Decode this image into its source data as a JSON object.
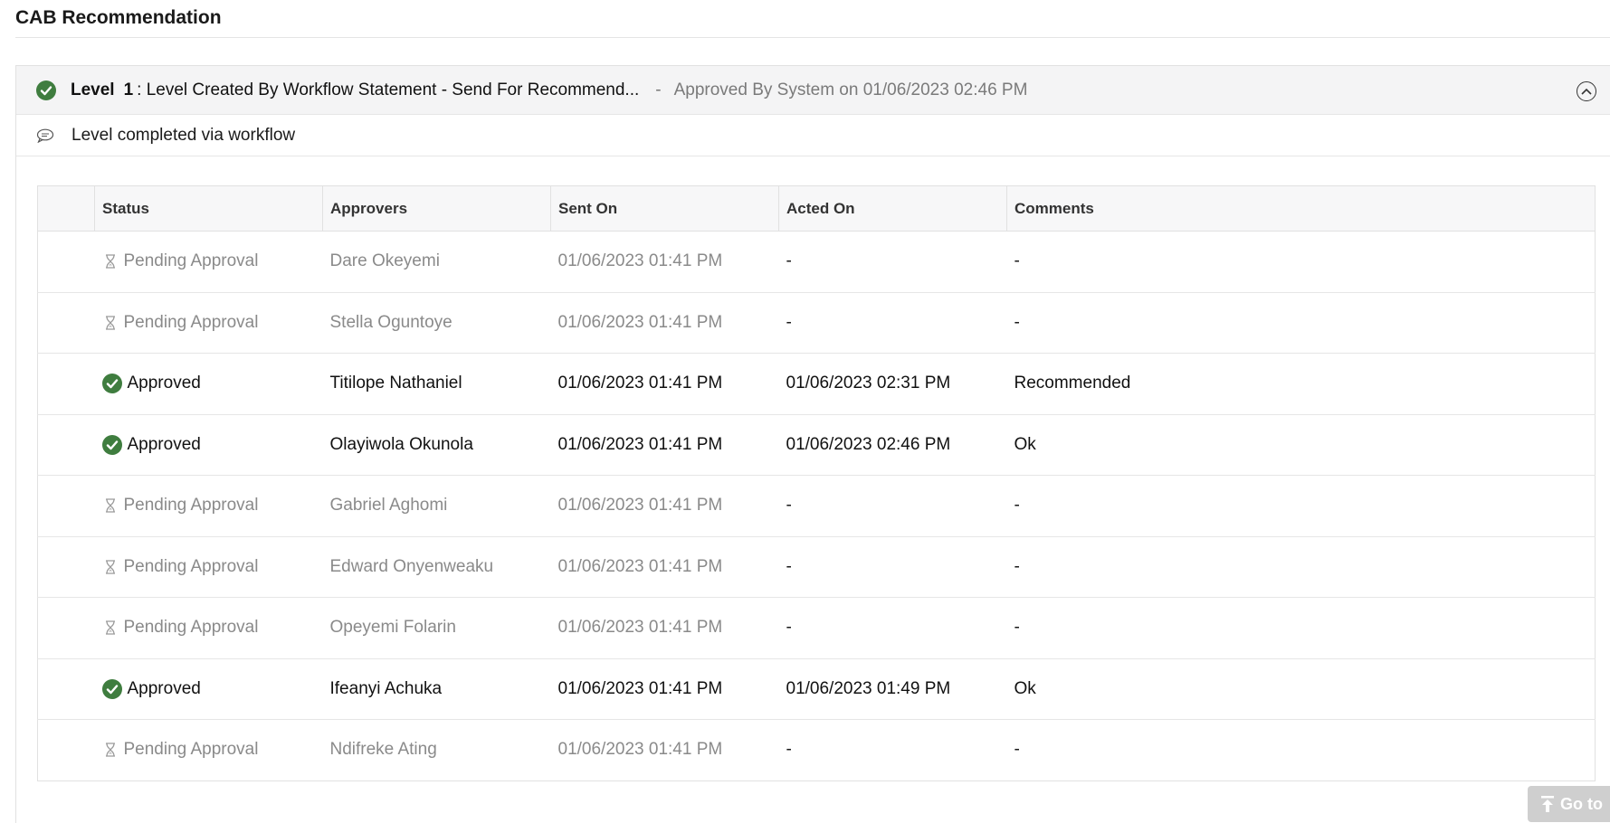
{
  "section": {
    "title": "CAB Recommendation"
  },
  "level": {
    "label": "Level",
    "number": "1",
    "name": ": Level Created By Workflow Statement - Send For Recommend...",
    "separator": "-",
    "approved_by": "Approved By System on 01/06/2023 02:46 PM",
    "note": "Level completed via workflow",
    "status_icon": "check-circle-icon",
    "collapse_icon": "chevron-up-circle-icon"
  },
  "table": {
    "headers": [
      "",
      "Status",
      "Approvers",
      "Sent On",
      "Acted On",
      "Comments"
    ],
    "rows": [
      {
        "status": "Pending Approval",
        "approver": "Dare Okeyemi",
        "sent_on": "01/06/2023 01:41 PM",
        "acted_on": "-",
        "comments": "-"
      },
      {
        "status": "Pending Approval",
        "approver": "Stella Oguntoye",
        "sent_on": "01/06/2023 01:41 PM",
        "acted_on": "-",
        "comments": "-"
      },
      {
        "status": "Approved",
        "approver": "Titilope Nathaniel",
        "sent_on": "01/06/2023 01:41 PM",
        "acted_on": "01/06/2023 02:31 PM",
        "comments": "Recommended"
      },
      {
        "status": "Approved",
        "approver": "Olayiwola Okunola",
        "sent_on": "01/06/2023 01:41 PM",
        "acted_on": "01/06/2023 02:46 PM",
        "comments": "Ok"
      },
      {
        "status": "Pending Approval",
        "approver": "Gabriel Aghomi",
        "sent_on": "01/06/2023 01:41 PM",
        "acted_on": "-",
        "comments": "-"
      },
      {
        "status": "Pending Approval",
        "approver": "Edward Onyenweaku",
        "sent_on": "01/06/2023 01:41 PM",
        "acted_on": "-",
        "comments": "-"
      },
      {
        "status": "Pending Approval",
        "approver": "Opeyemi Folarin",
        "sent_on": "01/06/2023 01:41 PM",
        "acted_on": "-",
        "comments": "-"
      },
      {
        "status": "Approved",
        "approver": "Ifeanyi Achuka",
        "sent_on": "01/06/2023 01:41 PM",
        "acted_on": "01/06/2023 01:49 PM",
        "comments": "Ok"
      },
      {
        "status": "Pending Approval",
        "approver": "Ndifreke Ating",
        "sent_on": "01/06/2023 01:41 PM",
        "acted_on": "-",
        "comments": "-"
      }
    ]
  },
  "goto": {
    "label": "Go to"
  },
  "colors": {
    "approved_green": "#3f7d3f",
    "pending_gray": "#8a8a8a"
  }
}
